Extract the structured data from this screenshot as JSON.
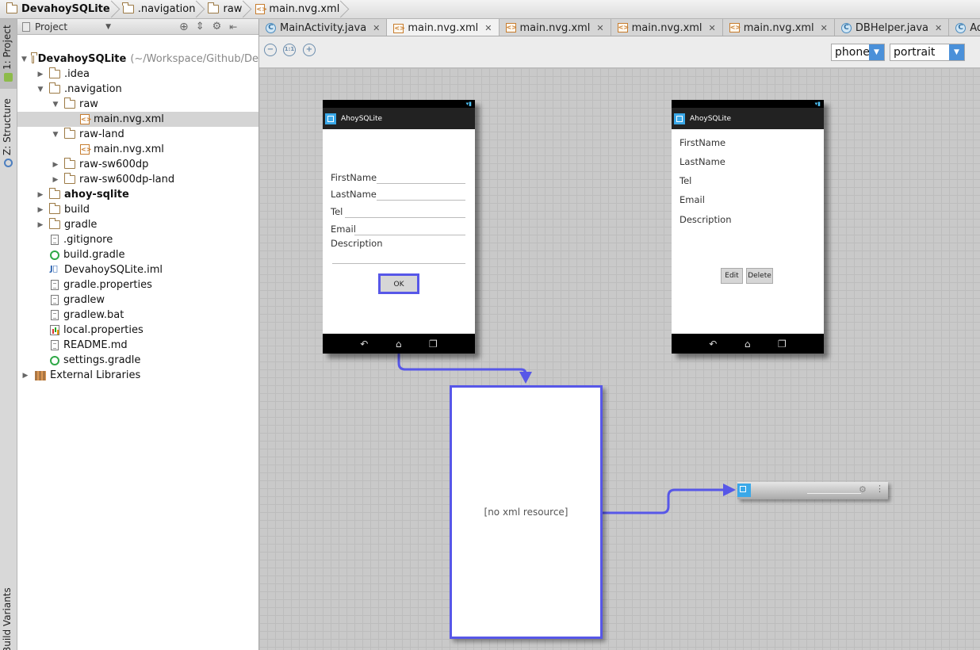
{
  "breadcrumb": [
    "DevahoySQLite",
    ".navigation",
    "raw",
    "main.nvg.xml"
  ],
  "side_tabs": {
    "project": "1: Project",
    "structure": "Z: Structure",
    "build_variants": "Build Variants"
  },
  "project_panel": {
    "title": "Project"
  },
  "tree": [
    {
      "label": "DevahoySQLite",
      "extra": "(~/Workspace/Github/De",
      "arrow": "▼",
      "icon": "folder",
      "bold": true
    },
    {
      "label": ".idea",
      "arrow": "▶",
      "icon": "folder"
    },
    {
      "label": ".navigation",
      "arrow": "▼",
      "icon": "folder"
    },
    {
      "label": "raw",
      "arrow": "▼",
      "icon": "folder"
    },
    {
      "label": "main.nvg.xml",
      "arrow": "",
      "icon": "xml",
      "selected": true
    },
    {
      "label": "raw-land",
      "arrow": "▼",
      "icon": "folder"
    },
    {
      "label": "main.nvg.xml",
      "arrow": "",
      "icon": "xml"
    },
    {
      "label": "raw-sw600dp",
      "arrow": "▶",
      "icon": "folder"
    },
    {
      "label": "raw-sw600dp-land",
      "arrow": "▶",
      "icon": "folder"
    },
    {
      "label": "ahoy-sqlite",
      "arrow": "▶",
      "icon": "folder",
      "bold": true
    },
    {
      "label": "build",
      "arrow": "▶",
      "icon": "folder"
    },
    {
      "label": "gradle",
      "arrow": "▶",
      "icon": "folder"
    },
    {
      "label": ".gitignore",
      "arrow": "",
      "icon": "file"
    },
    {
      "label": "build.gradle",
      "arrow": "",
      "icon": "gradle"
    },
    {
      "label": "DevahoySQLite.iml",
      "arrow": "",
      "icon": "iml"
    },
    {
      "label": "gradle.properties",
      "arrow": "",
      "icon": "file"
    },
    {
      "label": "gradlew",
      "arrow": "",
      "icon": "file"
    },
    {
      "label": "gradlew.bat",
      "arrow": "",
      "icon": "file"
    },
    {
      "label": "local.properties",
      "arrow": "",
      "icon": "props"
    },
    {
      "label": "README.md",
      "arrow": "",
      "icon": "file"
    },
    {
      "label": "settings.gradle",
      "arrow": "",
      "icon": "gradle"
    },
    {
      "label": "External Libraries",
      "arrow": "▶",
      "icon": "libs"
    }
  ],
  "tabs": [
    {
      "label": "MainActivity.java",
      "icon": "class"
    },
    {
      "label": "main.nvg.xml",
      "icon": "xml",
      "active": true
    },
    {
      "label": "main.nvg.xml",
      "icon": "xml"
    },
    {
      "label": "main.nvg.xml",
      "icon": "xml"
    },
    {
      "label": "main.nvg.xml",
      "icon": "xml"
    },
    {
      "label": "DBHelper.java",
      "icon": "class"
    },
    {
      "label": "AddFriendA",
      "icon": "class"
    }
  ],
  "toolbar": {
    "device": "phone",
    "orientation": "portrait"
  },
  "phone1": {
    "app_title": "AhoySQLite",
    "fields": [
      "FirstName",
      "LastName",
      "Tel",
      "Email",
      "Description"
    ],
    "ok": "OK"
  },
  "phone2": {
    "app_title": "AhoySQLite",
    "fields": [
      "FirstName",
      "LastName",
      "Tel",
      "Email",
      "Description"
    ],
    "edit": "Edit",
    "delete": "Delete"
  },
  "dialog": {
    "text": "[no xml resource]"
  },
  "colors": {
    "accent": "#5757e8",
    "android_blue": "#3aa8e8"
  }
}
